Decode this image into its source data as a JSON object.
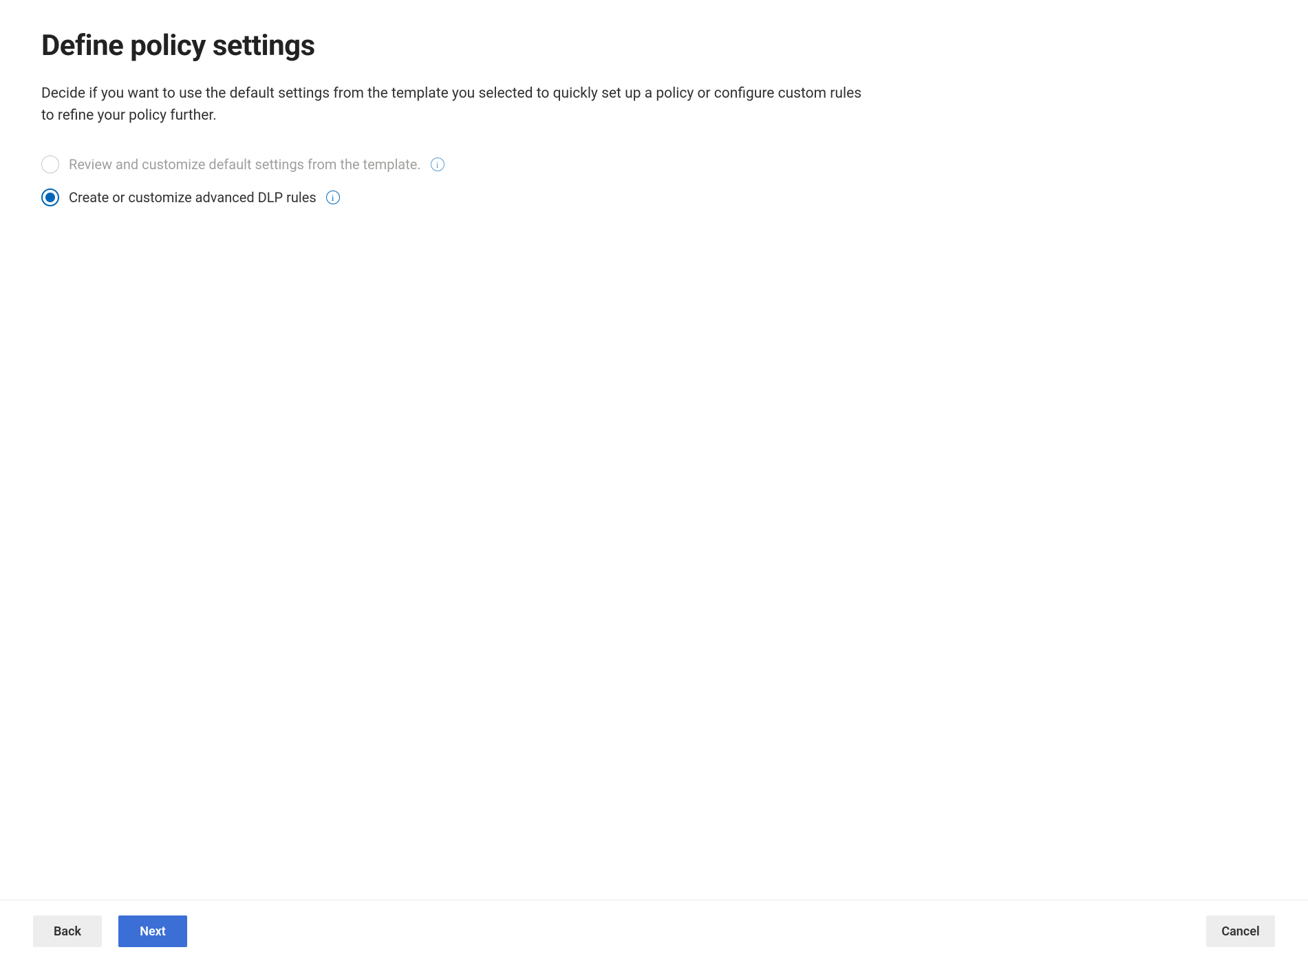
{
  "header": {
    "title": "Define policy settings",
    "description": "Decide if you want to use the default settings from the template you selected to quickly set up a policy or configure custom rules to refine your policy further."
  },
  "options": {
    "review_default": {
      "label": "Review and customize default settings from the template.",
      "selected": false,
      "disabled": true
    },
    "create_advanced": {
      "label": "Create or customize advanced DLP rules",
      "selected": true,
      "disabled": false
    }
  },
  "buttons": {
    "back": "Back",
    "next": "Next",
    "cancel": "Cancel"
  },
  "colors": {
    "accent": "#3b6fd6",
    "radio_selected": "#0067b8",
    "text": "#323130",
    "disabled_text": "#a19f9d",
    "button_default_bg": "#ededed",
    "border": "#edebe9"
  }
}
